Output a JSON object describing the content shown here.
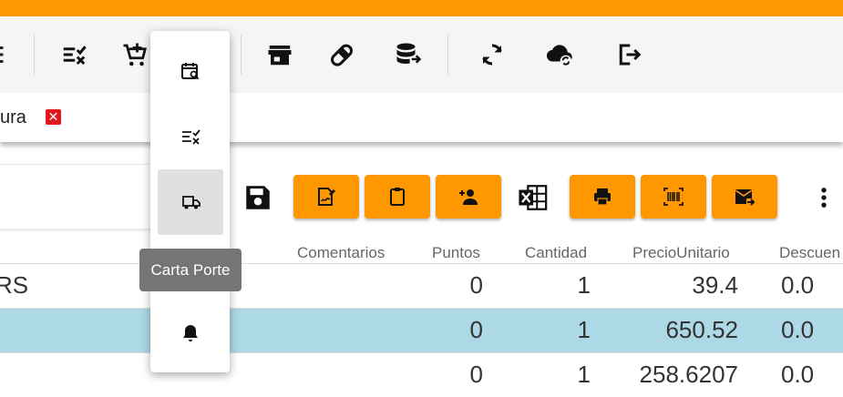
{
  "toolbar": {
    "accent": "#ff9800",
    "icons": [
      "list-check-icon",
      "cart-plus-icon",
      "store-icon",
      "pill-icon",
      "database-export-icon",
      "sync-icon",
      "cloud-sync-icon",
      "logout-icon"
    ]
  },
  "tabs": [
    {
      "label": "ura"
    }
  ],
  "actions": {
    "buttons": [
      "signature-icon",
      "clipboard-icon",
      "add-user-icon",
      "print-icon",
      "barcode-icon",
      "mail-forward-icon"
    ],
    "extra": [
      "save-icon",
      "excel-icon",
      "more-vertical-icon"
    ]
  },
  "menu": {
    "items": [
      "calendar-search-icon",
      "list-check-icon",
      "truck-icon",
      "bell-icon"
    ],
    "tooltip": "Carta Porte"
  },
  "table": {
    "columns": [
      "Comentarios",
      "Puntos",
      "Cantidad",
      "PrecioUnitario",
      "Descuen"
    ],
    "rows": [
      {
        "first": "RS",
        "puntos": "0",
        "cantidad": "1",
        "precio": "39.4",
        "descuento": "0.0",
        "selected": false
      },
      {
        "first": "",
        "puntos": "0",
        "cantidad": "1",
        "precio": "650.52",
        "descuento": "0.0",
        "selected": true
      },
      {
        "first": "",
        "puntos": "0",
        "cantidad": "1",
        "precio": "258.6207",
        "descuento": "0.0",
        "selected": false
      }
    ],
    "selected_color": "#add8e6"
  }
}
